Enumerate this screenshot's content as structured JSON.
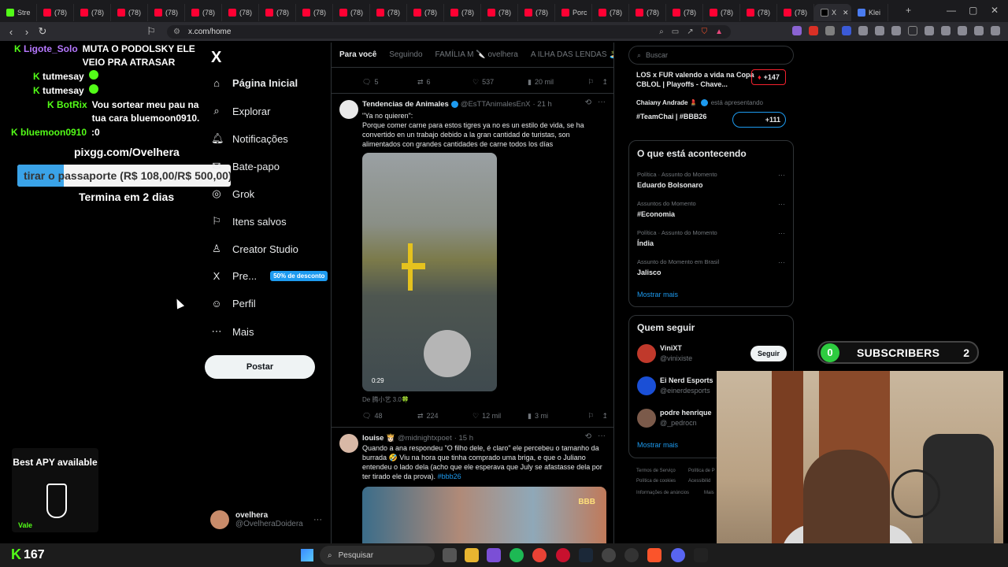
{
  "browser": {
    "tabs": [
      {
        "label": "Stre",
        "color": "#53fc18"
      },
      {
        "label": "(78)",
        "color": "#ff0033"
      },
      {
        "label": "(78)",
        "color": "#ff0033"
      },
      {
        "label": "(78)",
        "color": "#ff0033"
      },
      {
        "label": "(78)",
        "color": "#ff0033"
      },
      {
        "label": "(78)",
        "color": "#ff0033"
      },
      {
        "label": "(78)",
        "color": "#ff0033"
      },
      {
        "label": "(78)",
        "color": "#ff0033"
      },
      {
        "label": "(78)",
        "color": "#ff0033"
      },
      {
        "label": "(78)",
        "color": "#ff0033"
      },
      {
        "label": "(78)",
        "color": "#ff0033"
      },
      {
        "label": "(78)",
        "color": "#ff0033"
      },
      {
        "label": "(78)",
        "color": "#ff0033"
      },
      {
        "label": "(78)",
        "color": "#ff0033"
      },
      {
        "label": "(78)",
        "color": "#ff0033"
      },
      {
        "label": "Porc",
        "color": "#ff0033"
      },
      {
        "label": "(78)",
        "color": "#ff0033"
      },
      {
        "label": "(78)",
        "color": "#ff0033"
      },
      {
        "label": "(78)",
        "color": "#ff0033"
      },
      {
        "label": "(78)",
        "color": "#ff0033"
      },
      {
        "label": "(78)",
        "color": "#ff0033"
      },
      {
        "label": "(78)",
        "color": "#ff0033"
      }
    ],
    "active_tab": {
      "label": "X"
    },
    "last_tab": {
      "label": "Klei"
    },
    "url": "x.com/home"
  },
  "chat": [
    {
      "user": "Ligote_Solo",
      "user_color": "#b678ff",
      "msg": "MUTA O PODOLSKY ELE VEIO PRA ATRASAR",
      "indent": 18
    },
    {
      "user": "tutmesay",
      "user_color": "#ffffff",
      "msg": "",
      "emote": true,
      "indent": 42
    },
    {
      "user": "tutmesay",
      "user_color": "#ffffff",
      "msg": "",
      "emote": true,
      "indent": 42
    },
    {
      "user": "BotRix",
      "user_color": "#53fc18",
      "msg": "Vou sortear meu pau na tua cara bluemoon0910.",
      "indent": 60
    },
    {
      "user": "bluemoon0910",
      "user_color": "#53fc18",
      "msg": ":0",
      "indent": 14
    }
  ],
  "overlay": {
    "pix": "pixgg.com/Ovelhera",
    "goal_text": "tirar o passaporte (R$ 108,00/R$ 500,00)",
    "goal_fraction": 0.216,
    "goal_end": "Termina em 2 dias"
  },
  "xnav": {
    "logo": "X",
    "items": [
      {
        "label": "Página Inicial",
        "icon": "home-icon",
        "glyph": "⌂"
      },
      {
        "label": "Explorar",
        "icon": "search-icon",
        "glyph": "⌕"
      },
      {
        "label": "Notificações",
        "icon": "bell-icon",
        "glyph": "🔔︎"
      },
      {
        "label": "Bate-papo",
        "icon": "chat-icon",
        "glyph": "✉"
      },
      {
        "label": "Grok",
        "icon": "grok-icon",
        "glyph": "◎"
      },
      {
        "label": "Itens salvos",
        "icon": "bookmark-icon",
        "glyph": "⚐"
      },
      {
        "label": "Creator Studio",
        "icon": "creator-icon",
        "glyph": "♙"
      },
      {
        "label": "Pre...",
        "icon": "premium-x-icon",
        "glyph": "X"
      },
      {
        "label": "Perfil",
        "icon": "profile-icon",
        "glyph": "☺"
      },
      {
        "label": "Mais",
        "icon": "more-icon",
        "glyph": "⋯"
      }
    ],
    "premium_badge": "50% de desconto",
    "post_button": "Postar",
    "profile_name": "ovelhera",
    "profile_handle": "@OvelheraDoidera",
    "profile_menu": "···"
  },
  "timeline": {
    "tabs": [
      "Para você",
      "Seguindo",
      "FAMÍLIA M 🔪 ovelhera",
      "A ILHA DAS LENDAS 🏝️"
    ],
    "prev_actions": {
      "replies": "5",
      "reposts": "6",
      "likes": "537",
      "views": "20 mil"
    },
    "tweet1": {
      "name": "Tendencias de Animales",
      "handle": "@EsTTAnimalesEnX",
      "time": "· 21 h",
      "text1": "\"Ya no quieren\":",
      "text2": "Porque comer carne para estos tigres ya no es un estilo de vida, se ha convertido en un trabajo debido a la gran cantidad de turistas, son alimentados con grandes cantidades de carne todos los días",
      "video_time": "0:29",
      "source": "De 腾小艺 3.0🍀",
      "replies": "48",
      "reposts": "224",
      "likes": "12 mil",
      "views": "3 mi"
    },
    "tweet2": {
      "name": "louise 👸🏻",
      "handle": "@midnightxpoet",
      "time": "· 15 h",
      "text": "Quando a ana respondeu  \"O filho dele, é claro\" ele percebeu o tamanho da burrada 🤣 Viu na hora que tinha comprado uma briga, e que o Juliano entendeu o lado dela (acho que ele esperava que July se afastasse dela por ter tirado ele da prova).",
      "hashtag": "#bbb26",
      "image_label": "BBB"
    }
  },
  "right": {
    "search_placeholder": "Buscar",
    "promo1": "LOS x FUR valendo a vida na Copa CBLOL | Playoffs - Chave...",
    "promo1_count": "+147",
    "promo2_name": "Chaiany Andrade 💄",
    "promo2_status": "está apresentando",
    "promo2_tag": "#TeamChai | #BBB26",
    "promo2_count": "+111",
    "trends_title": "O que está acontecendo",
    "trends": [
      {
        "meta": "Política · Assunto do Momento",
        "name": "Eduardo Bolsonaro"
      },
      {
        "meta": "Assuntos do Momento",
        "name": "#Economia"
      },
      {
        "meta": "Política · Assunto do Momento",
        "name": "Índia"
      },
      {
        "meta": "Assunto do Momento em Brasil",
        "name": "Jalisco"
      }
    ],
    "show_more": "Mostrar mais",
    "who_title": "Quem seguir",
    "who": [
      {
        "name": "ViniXT",
        "handle": "@vinixiste",
        "color": "#c0392b"
      },
      {
        "name": "Ei Nerd Esports",
        "handle": "@einerdesports",
        "color": "#1a4fd6"
      },
      {
        "name": "podre henrique",
        "handle": "@_pedrocn",
        "color": "#7b5a4a"
      }
    ],
    "follow_label": "Seguir",
    "who_show_more": "Mostrar mais",
    "footer": [
      "Termos de Serviço",
      "Política de P",
      "Política de cookies",
      "Acessibilid",
      "Informações de anúncios",
      "Mais"
    ]
  },
  "subs": {
    "count": "0",
    "label": "SUBSCRIBERS",
    "goal": "2"
  },
  "apy": {
    "title": "Best APY available",
    "brand": "Vale"
  },
  "taskbar": {
    "kick_viewers": "167",
    "search_label": "Pesquisar"
  }
}
